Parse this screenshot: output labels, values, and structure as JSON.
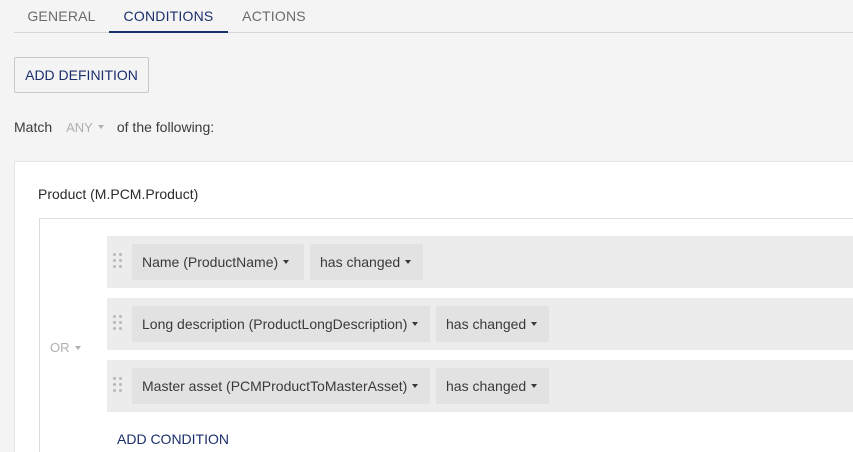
{
  "tabs": [
    {
      "label": "GENERAL"
    },
    {
      "label": "CONDITIONS"
    },
    {
      "label": "ACTIONS"
    }
  ],
  "add_definition_label": "ADD DEFINITION",
  "match": {
    "prefix": "Match",
    "selected": "ANY",
    "suffix": "of the following:"
  },
  "definition": {
    "title": "Product (M.PCM.Product)",
    "operator": "OR",
    "conditions": [
      {
        "field": "Name (ProductName)",
        "operator": "has changed"
      },
      {
        "field": "Long description (ProductLongDescription)",
        "operator": "has changed"
      },
      {
        "field": "Master asset (PCMProductToMasterAsset)",
        "operator": "has changed"
      }
    ],
    "add_condition_label": "ADD CONDITION"
  },
  "colors": {
    "accent": "#1b2f6b",
    "muted": "#b0b0b0",
    "pill_bg": "#e2e2e2",
    "row_bg": "#ececec"
  },
  "icons": {
    "drag_handle": "drag-handle-icon",
    "dropdown": "chevron-down-icon"
  }
}
